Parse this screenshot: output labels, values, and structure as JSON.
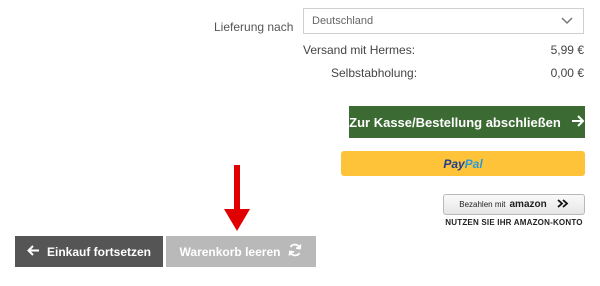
{
  "shipping": {
    "label": "Lieferung nach",
    "country": "Deutschland"
  },
  "costs": [
    {
      "label": "Versand mit Hermes:",
      "value": "5,99 €"
    },
    {
      "label": "Selbstabholung:",
      "value": "0,00 €"
    }
  ],
  "checkout": {
    "label": "Zur Kasse/Bestellung abschließen",
    "color": "#3b6b32"
  },
  "paypal": {
    "label_pay": "Pay",
    "label_pal": "Pal",
    "color": "#ffc33a"
  },
  "amazon": {
    "prefix": "Bezahlen mit",
    "brand": "amazon",
    "subtitle": "NUTZEN SIE IHR AMAZON-KONTO"
  },
  "buttons": {
    "continue": "Einkauf fortsetzen",
    "clear_cart": "Warenkorb leeren"
  },
  "annotation": {
    "color": "#e00000"
  }
}
